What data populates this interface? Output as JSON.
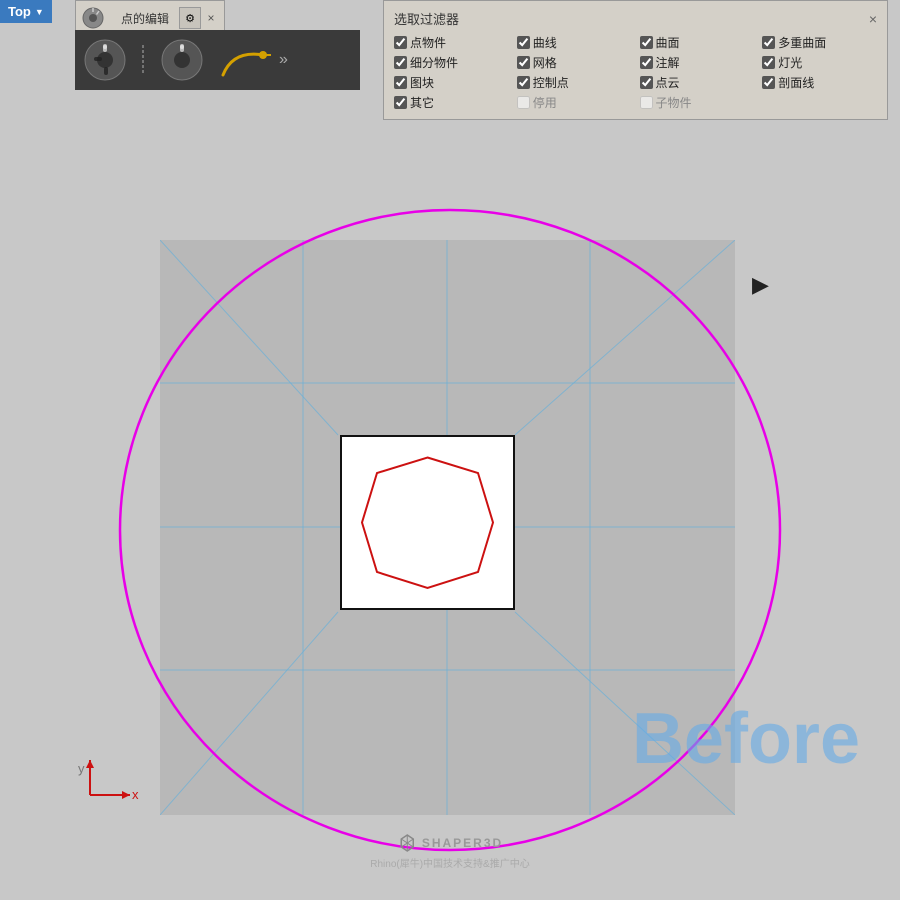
{
  "viewport_label": "Top",
  "viewport_arrow": "▼",
  "toolbar": {
    "title": "点的编辑",
    "gear_icon": "⚙",
    "close_icon": "×",
    "more_icon": "»"
  },
  "selection_filter": {
    "title": "选取过滤器",
    "close_icon": "×",
    "items": [
      {
        "label": "点物件",
        "checked": true,
        "disabled": false
      },
      {
        "label": "曲线",
        "checked": true,
        "disabled": false
      },
      {
        "label": "曲面",
        "checked": true,
        "disabled": false
      },
      {
        "label": "多重曲面",
        "checked": true,
        "disabled": false
      },
      {
        "label": "细分物件",
        "checked": true,
        "disabled": false
      },
      {
        "label": "网格",
        "checked": true,
        "disabled": false
      },
      {
        "label": "注解",
        "checked": true,
        "disabled": false
      },
      {
        "label": "灯光",
        "checked": true,
        "disabled": false
      },
      {
        "label": "图块",
        "checked": true,
        "disabled": false
      },
      {
        "label": "控制点",
        "checked": true,
        "disabled": false
      },
      {
        "label": "点云",
        "checked": true,
        "disabled": false
      },
      {
        "label": "剖面线",
        "checked": true,
        "disabled": false
      },
      {
        "label": "其它",
        "checked": true,
        "disabled": false
      },
      {
        "label": "停用",
        "checked": false,
        "disabled": true
      },
      {
        "label": "子物件",
        "checked": false,
        "disabled": true
      }
    ]
  },
  "before_text": "Before",
  "watermark_line1": "SHAPER3D",
  "watermark_line2": "Rhino(犀牛)中国技术支持&推广中心",
  "axes": {
    "x_label": "x",
    "y_label": "y"
  }
}
